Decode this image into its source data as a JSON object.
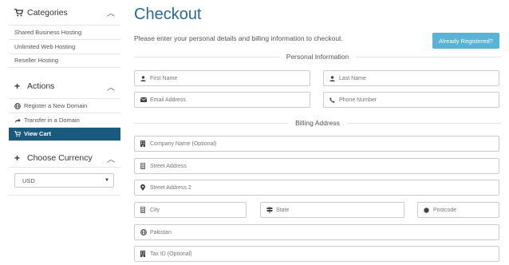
{
  "sidebar": {
    "categories": {
      "title": "Categories",
      "items": [
        "Shared Business Hosting",
        "Unlimited Web Hosting",
        "Reseller Hosting"
      ]
    },
    "actions": {
      "title": "Actions",
      "items": [
        "Register a New Domain",
        "Transfer in a Domain",
        "View Cart"
      ]
    },
    "currency": {
      "title": "Choose Currency",
      "selected": "USD"
    }
  },
  "main": {
    "title": "Checkout",
    "intro": "Please enter your personal details and billing information to checkout.",
    "already_registered": "Already Registered?",
    "personal_section": "Personal Information",
    "billing_section": "Billing Address",
    "fields": {
      "first_name": "First Name",
      "last_name": "Last Name",
      "email": "Email Address",
      "phone": "Phone Number",
      "company": "Company Name (Optional)",
      "street1": "Street Address",
      "street2": "Street Address 2",
      "city": "City",
      "state": "State",
      "postcode": "Postcode",
      "country": "Pakistan",
      "tax_id": "Tax ID (Optional)"
    }
  },
  "colors": {
    "accent": "#2a6a93",
    "active_bg": "#1b5a7f",
    "button_bg": "#57b3d8"
  }
}
